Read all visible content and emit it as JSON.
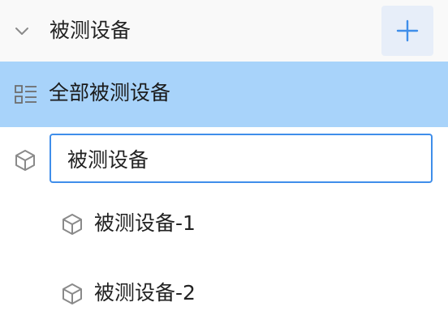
{
  "tree": {
    "header": {
      "title": "被测设备",
      "expand_icon": "chevron-down-icon",
      "add_icon": "plus-icon"
    },
    "all_item": {
      "label": "全部被测设备",
      "icon": "list-icon",
      "selected": true
    },
    "editing_item": {
      "value": "被测设备",
      "icon": "cube-icon"
    },
    "children": [
      {
        "label": "被测设备-1",
        "icon": "cube-icon"
      },
      {
        "label": "被测设备-2",
        "icon": "cube-icon"
      }
    ]
  },
  "colors": {
    "header_bg": "#f9f9f9",
    "selected_bg": "#a8d3fa",
    "add_button_bg": "#e7eef9",
    "accent": "#3f8eea",
    "icon_gray": "#8a8a8a"
  }
}
